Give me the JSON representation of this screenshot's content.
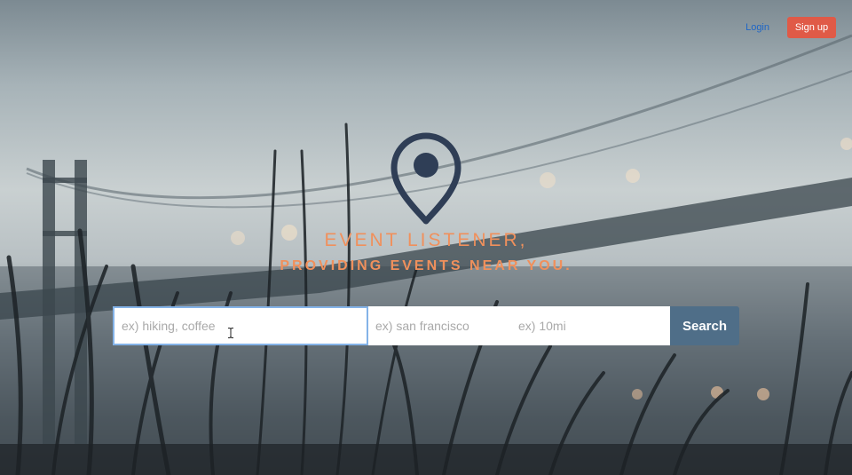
{
  "header": {
    "login_label": "Login",
    "signup_label": "Sign up"
  },
  "hero": {
    "icon": "map-pin-icon",
    "title_line1": "EVENT LISTENER,",
    "title_line2": "PROVIDING EVENTS NEAR YOU."
  },
  "search": {
    "keyword_placeholder": "ex) hiking, coffee",
    "keyword_value": "",
    "location_placeholder": "ex) san francisco",
    "location_value": "",
    "radius_placeholder": "ex) 10mi",
    "radius_value": "",
    "button_label": "Search"
  },
  "colors": {
    "accent_orange": "#f0905c",
    "signup_red": "#e05a47",
    "search_blue": "#4f6e88",
    "link_blue": "#1e66c6",
    "pin_navy": "#2f3e56"
  }
}
